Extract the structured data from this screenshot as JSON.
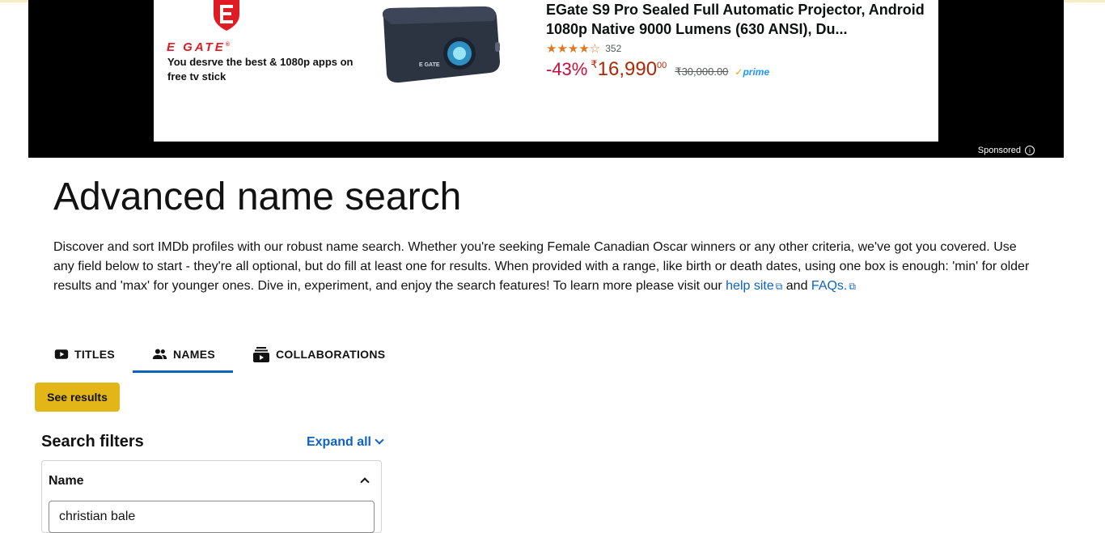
{
  "ad": {
    "brand_name": "E GATE",
    "brand_tagline": "You desrve the best & 1080p apps on free tv stick",
    "product_title": "EGate S9 Pro Sealed Full Automatic Projector, Android 1080p Native 9000 Lumens (630 ANSI), Du...",
    "rating_stars": 4,
    "rating_count": "352",
    "discount": "-43%",
    "price_symbol": "₹",
    "price_whole": "16,990",
    "price_fraction": "00",
    "mrp": "₹30,000.00",
    "prime_label": "prime",
    "sponsored_label": "Sponsored"
  },
  "page": {
    "title": "Advanced name search",
    "intro_text": "Discover and sort IMDb profiles with our robust name search. Whether you're seeking Female Canadian Oscar winners or any other criteria, we've got you covered. Use any field below to start - they're all optional, but do fill at least one for results. When provided with a range, like birth or death dates, using one box is enough: 'min' for older results and 'max' for younger ones. Dive in, experiment, and enjoy the search features! To learn more please visit our",
    "help_link": "help site",
    "and_text": "and",
    "faqs_link": "FAQs."
  },
  "tabs": [
    {
      "label": "TITLES",
      "icon": "video-icon",
      "active": false
    },
    {
      "label": "NAMES",
      "icon": "people-icon",
      "active": true
    },
    {
      "label": "COLLABORATIONS",
      "icon": "collections-icon",
      "active": false
    }
  ],
  "see_results_label": "See results",
  "filters": {
    "title": "Search filters",
    "expand_all": "Expand all",
    "name_section": {
      "label": "Name",
      "input_value": "christian bale"
    }
  },
  "colors": {
    "accent": "#0e63be",
    "button": "#e2b616",
    "ad_price": "#b12704",
    "ad_discount": "#cc0c39"
  }
}
